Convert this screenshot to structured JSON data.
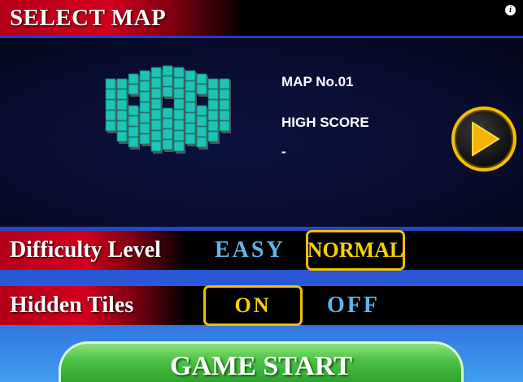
{
  "header": {
    "title": "SELECT MAP",
    "info_icon": "info-icon"
  },
  "map": {
    "number_label": "MAP No.01",
    "high_score_label": "HIGH SCORE",
    "high_score_value": "-",
    "tile_color": "#1fc4b4",
    "next_icon": "play-arrow-icon"
  },
  "difficulty": {
    "label": "Difficulty Level",
    "options": [
      "EASY",
      "NORMAL"
    ],
    "selected": "NORMAL"
  },
  "hidden_tiles": {
    "label": "Hidden Tiles",
    "options": [
      "ON",
      "OFF"
    ],
    "selected": "ON"
  },
  "start": {
    "label": "GAME START"
  },
  "colors": {
    "accent": "#f2c000",
    "header_red": "#d0001e",
    "option_blue": "#5fb6ee",
    "start_green": "#3bb236"
  }
}
